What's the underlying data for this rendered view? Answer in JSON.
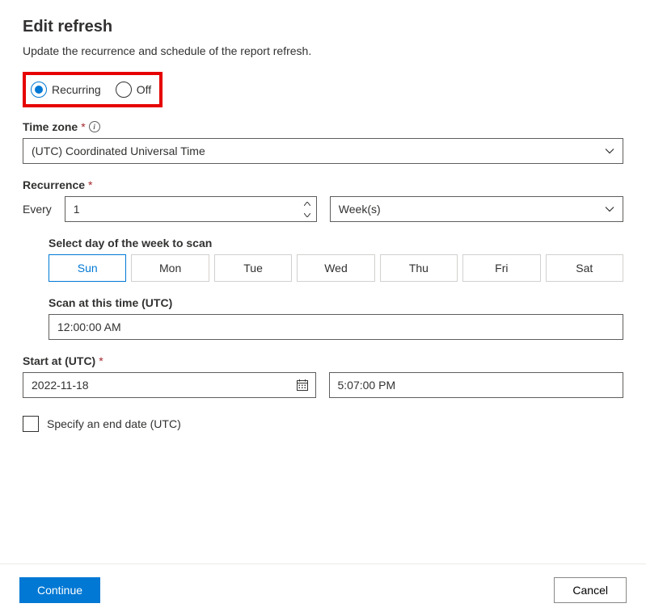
{
  "header": {
    "title": "Edit refresh",
    "subtitle": "Update the recurrence and schedule of the report refresh."
  },
  "mode": {
    "recurring_label": "Recurring",
    "off_label": "Off",
    "selected": "recurring"
  },
  "timezone": {
    "label": "Time zone",
    "value": "(UTC) Coordinated Universal Time"
  },
  "recurrence": {
    "label": "Recurrence",
    "every_label": "Every",
    "every_value": "1",
    "unit_value": "Week(s)"
  },
  "days": {
    "label": "Select day of the week to scan",
    "items": [
      "Sun",
      "Mon",
      "Tue",
      "Wed",
      "Thu",
      "Fri",
      "Sat"
    ],
    "selected": "Sun"
  },
  "scan_time": {
    "label": "Scan at this time (UTC)",
    "value": "12:00:00 AM"
  },
  "start": {
    "label": "Start at (UTC)",
    "date": "2022-11-18",
    "time": "5:07:00 PM"
  },
  "end_date": {
    "label": "Specify an end date (UTC)",
    "checked": false
  },
  "footer": {
    "continue_label": "Continue",
    "cancel_label": "Cancel"
  }
}
